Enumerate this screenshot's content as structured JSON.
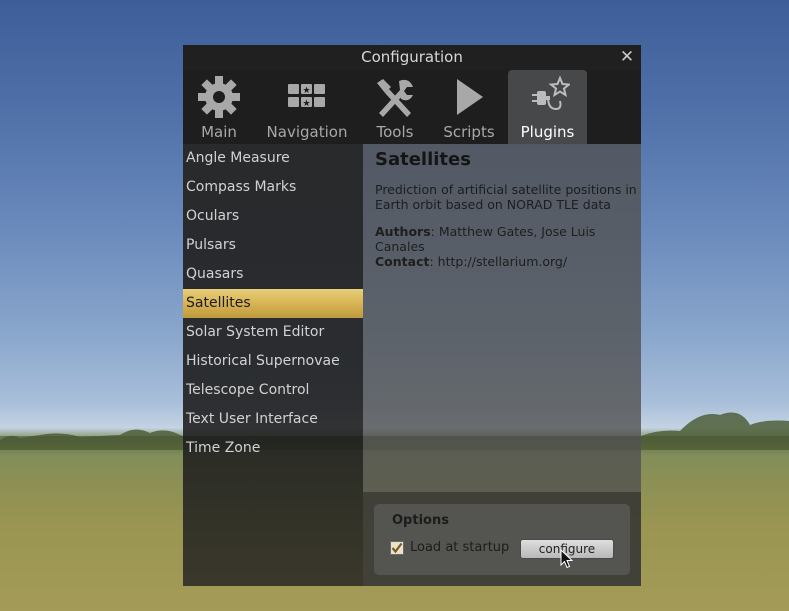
{
  "window": {
    "title": "Configuration"
  },
  "tabs": [
    {
      "label": "Main",
      "icon": "gear-icon"
    },
    {
      "label": "Navigation",
      "icon": "navigation-keys-icon"
    },
    {
      "label": "Tools",
      "icon": "tools-icon"
    },
    {
      "label": "Scripts",
      "icon": "play-icon"
    },
    {
      "label": "Plugins",
      "icon": "plugin-icon",
      "active": true
    }
  ],
  "plugins": [
    "Angle Measure",
    "Compass Marks",
    "Oculars",
    "Pulsars",
    "Quasars",
    "Satellites",
    "Solar System Editor",
    "Historical Supernovae",
    "Telescope Control",
    "Text User Interface",
    "Time Zone"
  ],
  "selected_plugin": "Satellites",
  "detail": {
    "title": "Satellites",
    "description": "Prediction of artificial satellite positions in Earth orbit based on NORAD TLE data",
    "authors_label": "Authors",
    "authors": "Matthew Gates, Jose Luis Canales",
    "contact_label": "Contact",
    "contact": "http://stellarium.org/"
  },
  "options": {
    "title": "Options",
    "load_at_startup_label": "Load at startup",
    "load_at_startup_checked": true,
    "configure_label": "configure"
  },
  "colors": {
    "selection": "#d9b657",
    "active_tab": "#474849"
  }
}
